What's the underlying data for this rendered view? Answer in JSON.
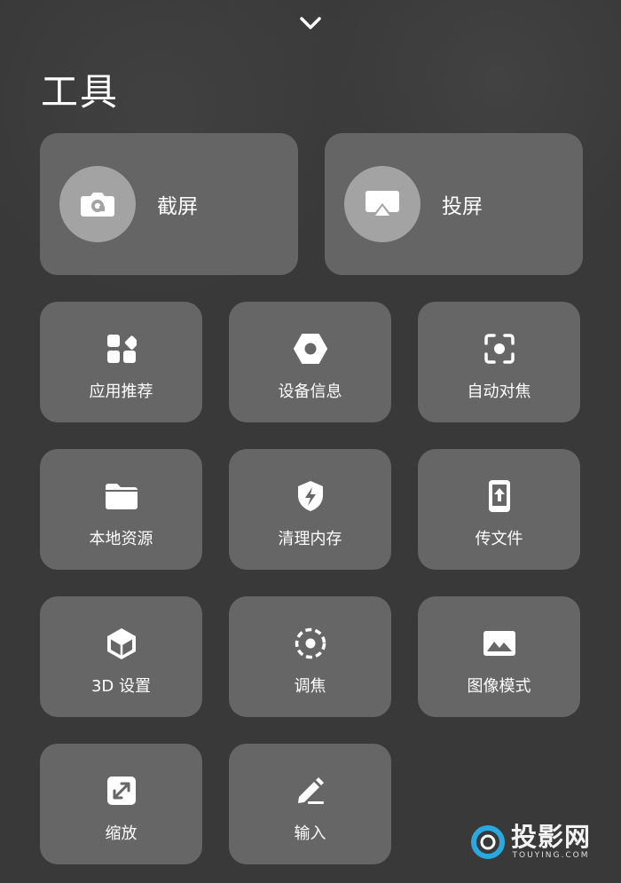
{
  "header": {
    "collapse_icon": "chevron-down-icon",
    "title": "工具"
  },
  "big_tiles": [
    {
      "label": "截屏",
      "icon": "camera-icon"
    },
    {
      "label": "投屏",
      "icon": "screen-cast-icon"
    }
  ],
  "tiles": [
    {
      "label": "应用推荐",
      "icon": "apps-icon"
    },
    {
      "label": "设备信息",
      "icon": "hexagon-nut-icon"
    },
    {
      "label": "自动对焦",
      "icon": "focus-frame-icon"
    },
    {
      "label": "本地资源",
      "icon": "folder-icon"
    },
    {
      "label": "清理内存",
      "icon": "shield-bolt-icon"
    },
    {
      "label": "传文件",
      "icon": "phone-upload-icon"
    },
    {
      "label": "3D 设置",
      "icon": "cube-icon"
    },
    {
      "label": "调焦",
      "icon": "dashed-target-icon"
    },
    {
      "label": "图像模式",
      "icon": "image-icon"
    },
    {
      "label": "缩放",
      "icon": "expand-arrows-icon"
    },
    {
      "label": "输入",
      "icon": "pencil-icon"
    }
  ],
  "watermark": {
    "brand_cn": "投影网",
    "brand_en": "TOUYING.COM",
    "accent": "#2aa9e0"
  }
}
